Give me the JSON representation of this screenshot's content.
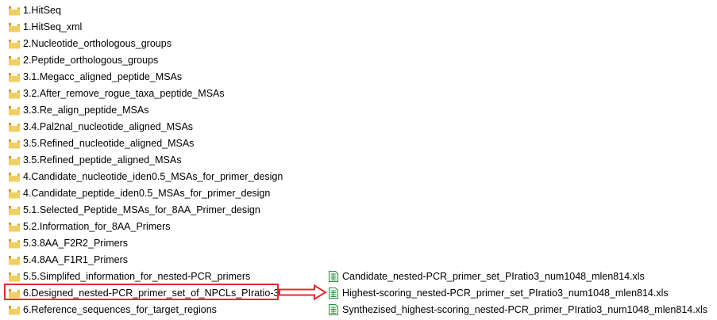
{
  "folders": [
    {
      "label": "1.HitSeq"
    },
    {
      "label": "1.HitSeq_xml"
    },
    {
      "label": "2.Nucleotide_orthologous_groups"
    },
    {
      "label": "2.Peptide_orthologous_groups"
    },
    {
      "label": "3.1.Megacc_aligned_peptide_MSAs"
    },
    {
      "label": "3.2.After_remove_rogue_taxa_peptide_MSAs"
    },
    {
      "label": "3.3.Re_align_peptide_MSAs"
    },
    {
      "label": "3.4.Pal2nal_nucleotide_aligned_MSAs"
    },
    {
      "label": "3.5.Refined_nucleotide_aligned_MSAs"
    },
    {
      "label": "3.5.Refined_peptide_aligned_MSAs"
    },
    {
      "label": "4.Candidate_nucleotide_iden0.5_MSAs_for_primer_design"
    },
    {
      "label": "4.Candidate_peptide_iden0.5_MSAs_for_primer_design"
    },
    {
      "label": "5.1.Selected_Peptide_MSAs_for_8AA_Primer_design"
    },
    {
      "label": "5.2.Information_for_8AA_Primers"
    },
    {
      "label": "5.3.8AA_F2R2_Primers"
    },
    {
      "label": "5.4.8AA_F1R1_Primers"
    },
    {
      "label": "5.5.Simplifed_information_for_nested-PCR_primers"
    },
    {
      "label": "6.Designed_nested-PCR_primer_set_of_NPCLs_PIratio-3"
    },
    {
      "label": "6.Reference_sequences_for_target_regions"
    }
  ],
  "files": [
    {
      "label": "Candidate_nested-PCR_primer_set_PIratio3_num1048_mlen814.xls"
    },
    {
      "label": "Highest-scoring_nested-PCR_primer_set_PIratio3_num1048_mlen814.xls"
    },
    {
      "label": "Synthezised_highest-scoring_nested-PCR_primer_PIratio3_num1048_mlen814.xls"
    }
  ],
  "icons": {
    "folder": "folder-icon",
    "file": "excel-file-icon",
    "arrow": "right-arrow"
  },
  "colors": {
    "highlight": "#e8282d",
    "folder_body": "#e8c04a",
    "folder_dark": "#c9962a",
    "file_green": "#2e8b3a"
  }
}
